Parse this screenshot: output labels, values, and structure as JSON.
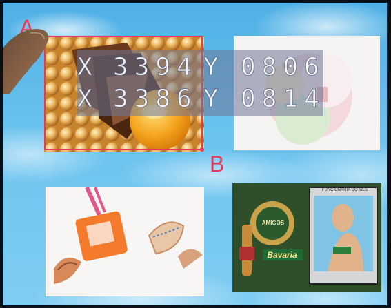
{
  "markers": {
    "start": "A",
    "end": "B"
  },
  "coordinates": {
    "rows": [
      {
        "x_label": "X",
        "x_value": "3394",
        "y_label": "Y",
        "y_value": "0806"
      },
      {
        "x_label": "X",
        "x_value": "3386",
        "y_label": "Y",
        "y_value": "0814"
      }
    ]
  },
  "thumbnails": {
    "beer_ad": {
      "header_text": "FUNCIONARIA DO MÊS",
      "brand_text": "Bavaria",
      "sub_text": "AMIGOS"
    }
  },
  "colors": {
    "selection": "#e8395a",
    "sky": "#6cc3ef",
    "overlay": "#6e7696"
  }
}
